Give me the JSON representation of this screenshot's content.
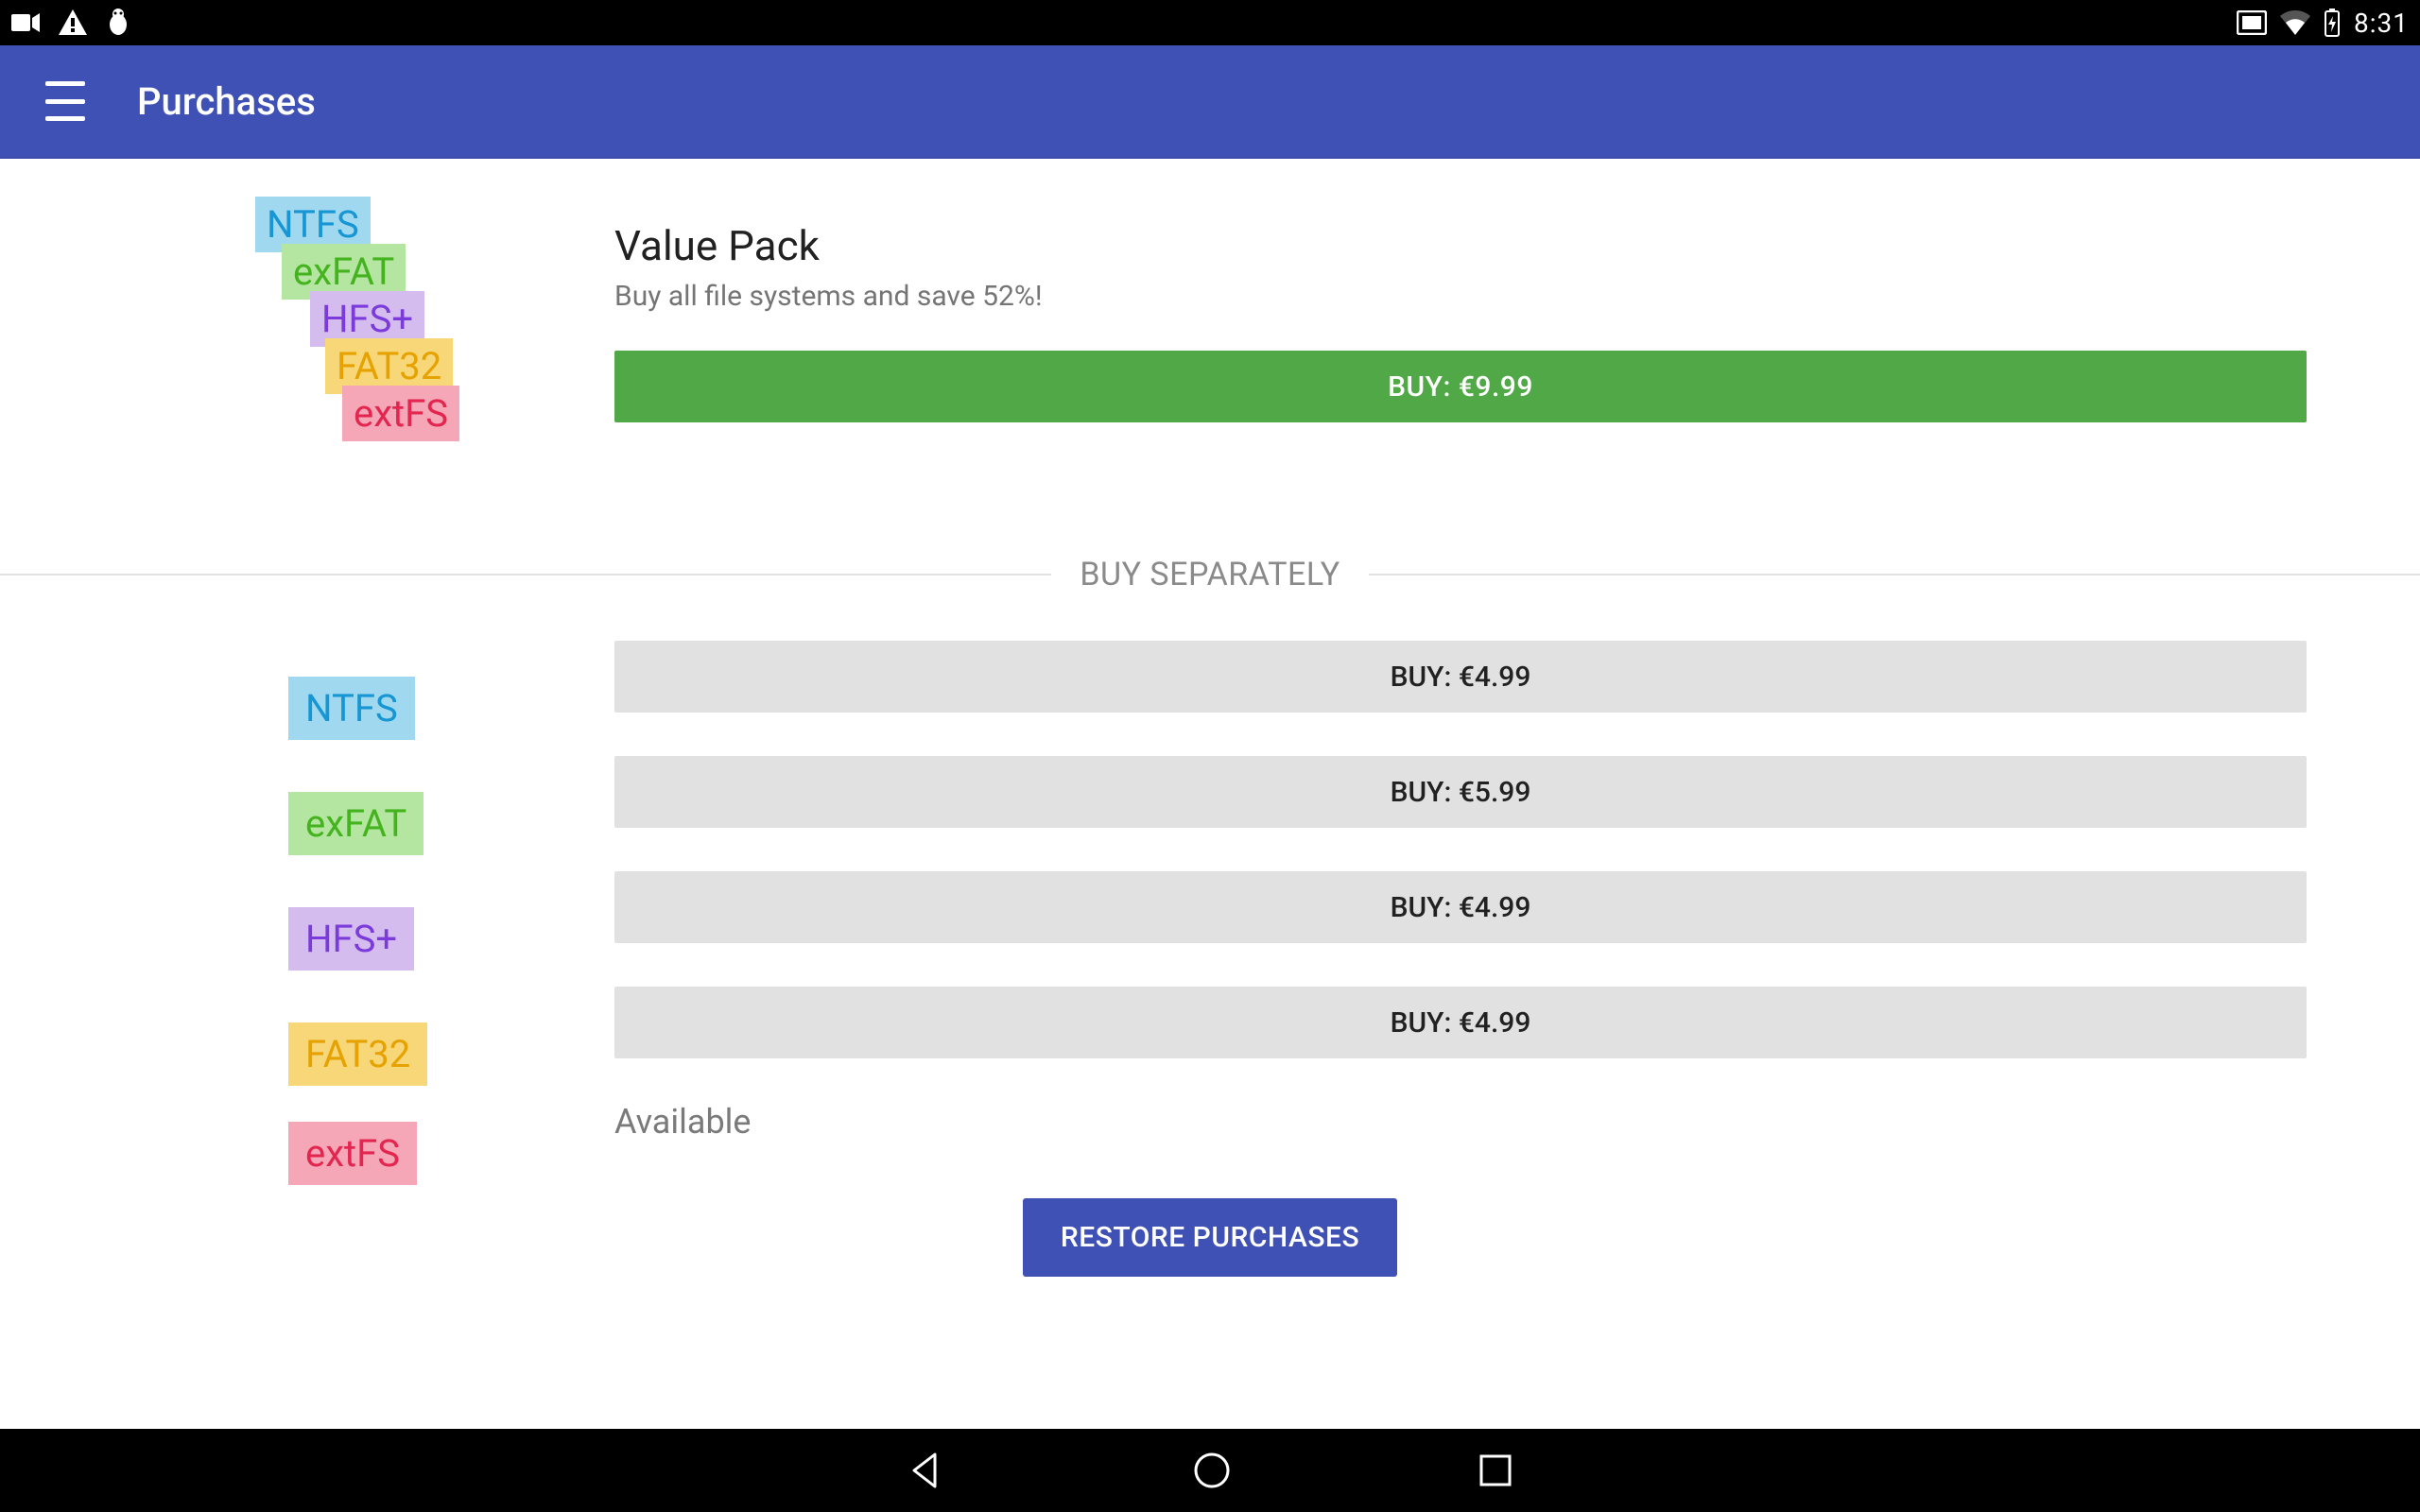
{
  "status": {
    "time": "8:31"
  },
  "appbar": {
    "title": "Purchases"
  },
  "value_pack": {
    "title": "Value Pack",
    "subtitle": "Buy all file systems and save 52%!",
    "buy_label": "BUY: €9.99",
    "badges": [
      "NTFS",
      "exFAT",
      "HFS+",
      "FAT32",
      "extFS"
    ]
  },
  "separator_label": "BUY SEPARATELY",
  "items": [
    {
      "name": "NTFS",
      "kind": "ntfs",
      "buy_label": "BUY: €4.99",
      "status": "buy"
    },
    {
      "name": "exFAT",
      "kind": "exfat",
      "buy_label": "BUY: €5.99",
      "status": "buy"
    },
    {
      "name": "HFS+",
      "kind": "hfs",
      "buy_label": "BUY: €4.99",
      "status": "buy"
    },
    {
      "name": "FAT32",
      "kind": "fat32",
      "buy_label": "BUY: €4.99",
      "status": "buy"
    },
    {
      "name": "extFS",
      "kind": "extfs",
      "status_text": "Available",
      "status": "available"
    }
  ],
  "restore_label": "RESTORE PURCHASES",
  "colors": {
    "accent": "#3f51b5",
    "buy_green": "#51a846"
  }
}
